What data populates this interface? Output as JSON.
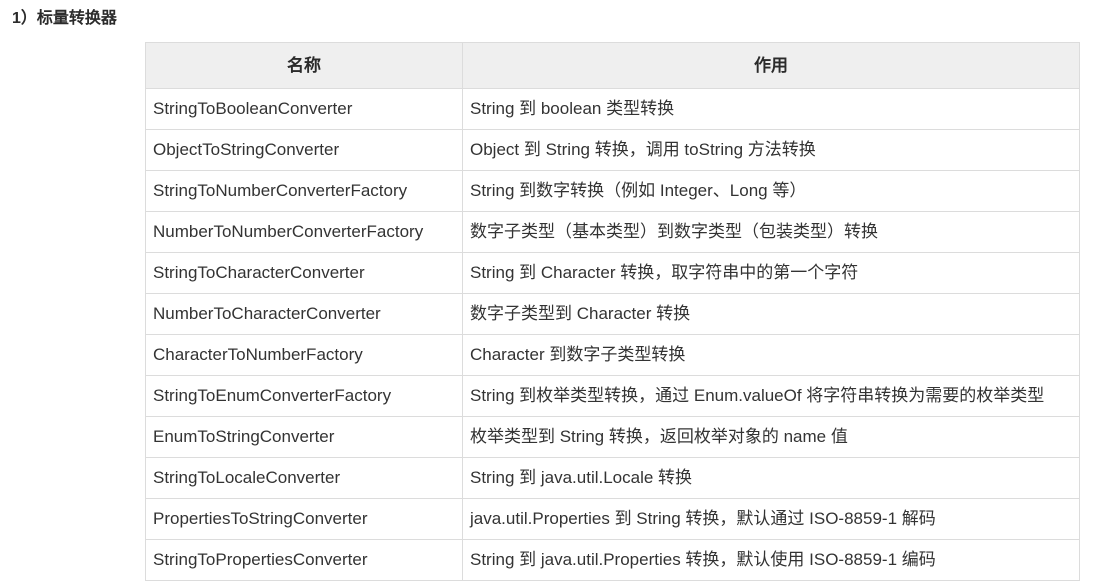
{
  "heading": "1）标量转换器",
  "table": {
    "headers": [
      "名称",
      "作用"
    ],
    "rows": [
      [
        "StringToBooleanConverter",
        "String 到 boolean 类型转换"
      ],
      [
        "ObjectToStringConverter",
        "Object 到 String 转换，调用 toString 方法转换"
      ],
      [
        "StringToNumberConverterFactory",
        "String 到数字转换（例如 Integer、Long 等）"
      ],
      [
        "NumberToNumberConverterFactory",
        "数字子类型（基本类型）到数字类型（包装类型）转换"
      ],
      [
        "StringToCharacterConverter",
        "String 到 Character 转换，取字符串中的第一个字符"
      ],
      [
        "NumberToCharacterConverter",
        "数字子类型到 Character 转换"
      ],
      [
        "CharacterToNumberFactory",
        "Character 到数字子类型转换"
      ],
      [
        "StringToEnumConverterFactory",
        "String 到枚举类型转换，通过 Enum.valueOf 将字符串转换为需要的枚举类型"
      ],
      [
        "EnumToStringConverter",
        "枚举类型到 String 转换，返回枚举对象的 name 值"
      ],
      [
        "StringToLocaleConverter",
        "String 到 java.util.Locale 转换"
      ],
      [
        "PropertiesToStringConverter",
        "java.util.Properties 到 String 转换，默认通过 ISO-8859-1 解码"
      ],
      [
        "StringToPropertiesConverter",
        "String 到 java.util.Properties 转换，默认使用 ISO-8859-1 编码"
      ]
    ]
  }
}
